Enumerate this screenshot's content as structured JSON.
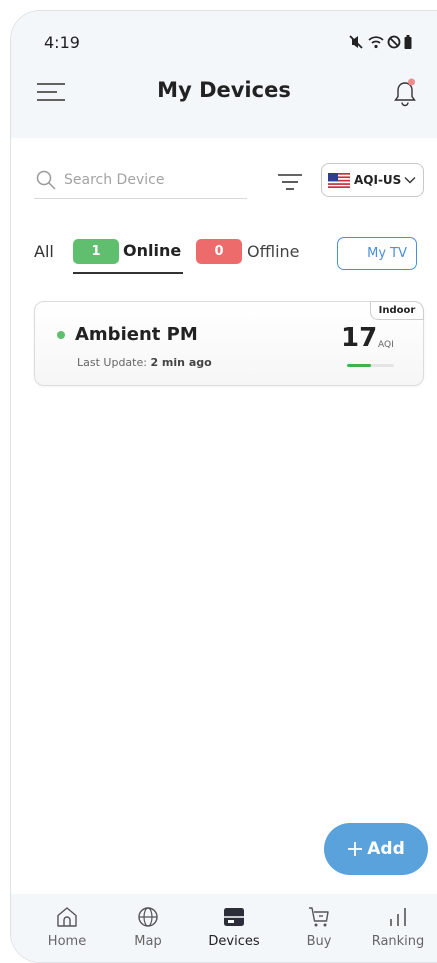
{
  "status_bar": {
    "time": "4:19"
  },
  "header": {
    "title": "My Devices"
  },
  "search": {
    "placeholder": "Search Device",
    "value": ""
  },
  "aqi_standard": {
    "label": "AQI-US"
  },
  "tabs": {
    "all_label": "All",
    "online_count": "1",
    "online_label": "Online",
    "offline_count": "0",
    "offline_label": "Offline"
  },
  "my_tv": {
    "label": "My TV"
  },
  "devices": [
    {
      "tag": "Indoor",
      "name": "Ambient PM",
      "last_update_prefix": "Last Update:",
      "last_update_value": "2 min ago",
      "aqi": "17",
      "aqi_unit": "AQI",
      "aqi_level_fraction": 0.5,
      "status": "online"
    }
  ],
  "add_button": {
    "label": "Add"
  },
  "bottom_nav": [
    {
      "label": "Home",
      "icon": "home-icon"
    },
    {
      "label": "Map",
      "icon": "globe-icon"
    },
    {
      "label": "Devices",
      "icon": "devices-icon"
    },
    {
      "label": "Buy",
      "icon": "cart-icon"
    },
    {
      "label": "Ranking",
      "icon": "ranking-icon"
    }
  ],
  "colors": {
    "accent": "#5aa2dc",
    "online": "#5fbf6f",
    "offline": "#ee6b6b",
    "aqi_good": "#3bb54a",
    "my_tv_border": "#4a8fd8"
  }
}
